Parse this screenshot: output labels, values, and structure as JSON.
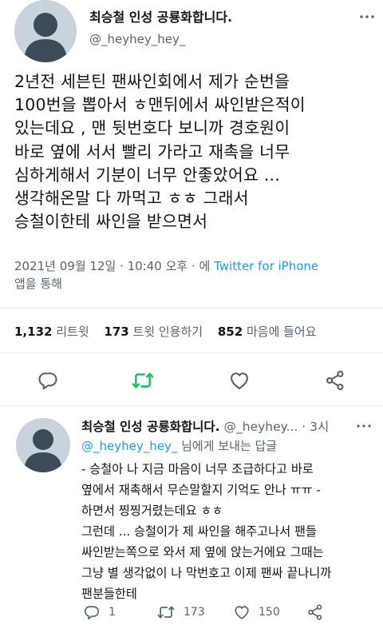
{
  "main_tweet": {
    "display_name": "최승철 인성 공룡화합니다.",
    "handle": "@_heyhey_hey_",
    "text_lines": [
      "2년전 세븐틴 팬싸인회에서 제가 순번을",
      "100번을 뽑아서 ㅎ맨뒤에서 싸인받은적이",
      "있는데요 , 맨 뒷번호다 보니까 경호원이",
      "바로 옆에 서서 빨리 가라고 재촉을 너무",
      "심하게해서 기분이 너무 안좋았어요 ...",
      "생각해온말 다 까먹고 ㅎㅎ 그래서",
      "승철이한테 싸인을 받으면서"
    ],
    "timestamp": "2021년 09월 12일 · 10:40 오후 · 에",
    "source": "Twitter for iPhone",
    "source_suffix": "앱을 통해",
    "stats": {
      "retweets_count": "1,132",
      "retweets_label": "리트윗",
      "quotes_count": "173",
      "quotes_label": "트윗 인용하기",
      "likes_count": "852",
      "likes_label": "마음에 들어요"
    },
    "icons": [
      "reply-icon",
      "retweet-icon",
      "like-icon",
      "share-icon"
    ],
    "retweet_color": "#17bf63"
  },
  "reply_tweet": {
    "display_name": "최승철 인성 공룡화합니다.",
    "handle_time": "@_heyhey... · 3시",
    "replying_to_handle": "@_heyhey_hey_",
    "replying_to_suffix": " 님에게 보내는 답글",
    "text_lines": [
      "- 승철아 나 지금 마음이 너무 조급하다고 바로",
      "옆에서 재촉해서 무슨말할지 기억도 안나 ㅠㅠ  -",
      "하면서 찡찡거렸는데요 ㅎㅎ",
      "그런데 ... 승철이가 제 싸인을 해주고나서 팬들",
      "싸인받는쪽으로 와서 제 옆에 앉는거에요  그때는",
      "그냥 별 생각없이 나 막번호고 이제 팬싸 끝나니까",
      "팬분들한테"
    ],
    "actions": {
      "reply_count": "1",
      "retweet_count": "173",
      "like_count": "150"
    }
  },
  "colors": {
    "link": "#1d9bf0",
    "muted": "#536471",
    "avatar_bg": "#c9d3dc",
    "avatar_fg": "#3c4b57"
  }
}
